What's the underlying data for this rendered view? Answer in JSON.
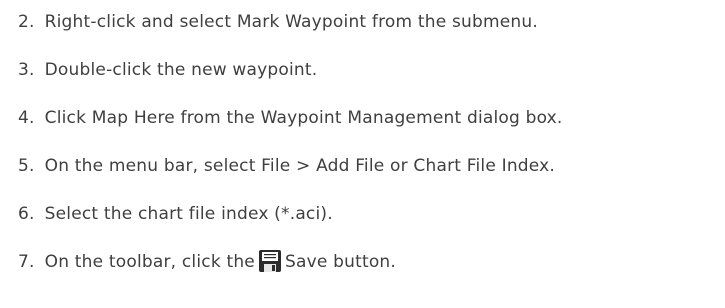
{
  "steps": [
    {
      "number": "2.",
      "text": "Right-click and select Mark Waypoint from the submenu."
    },
    {
      "number": "3.",
      "text": "Double-click the new waypoint."
    },
    {
      "number": "4.",
      "text": "Click Map Here from the Waypoint Management dialog box."
    },
    {
      "number": "5.",
      "text": "On the menu bar, select File > Add File or Chart File Index."
    },
    {
      "number": "6.",
      "text": "Select the chart file index (*.aci)."
    },
    {
      "number": "7.",
      "text_before": "On the toolbar, click the",
      "icon": "save-icon",
      "text_after": "Save button."
    }
  ],
  "colors": {
    "text": "#3f3f3f",
    "icon_body": "#2b2b2b",
    "icon_label": "#ffffff",
    "icon_shutter": "#e6e6e6"
  }
}
